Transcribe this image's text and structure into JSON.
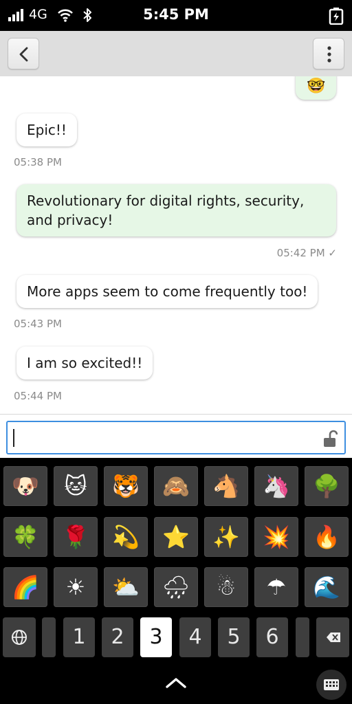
{
  "status_bar": {
    "network": "4G",
    "time": "5:45 PM",
    "icons": [
      "signal-icon",
      "wifi-icon",
      "bluetooth-icon",
      "battery-charging-icon"
    ]
  },
  "header": {
    "back_icon": "chevron-left-icon",
    "menu_icon": "kebab-menu-icon"
  },
  "messages": [
    {
      "direction": "outgoing",
      "text": "🤓"
    },
    {
      "direction": "incoming",
      "text": "Epic!!",
      "time": "05:38 PM"
    },
    {
      "direction": "outgoing",
      "text": "Revolutionary for digital rights, security, and privacy!",
      "time": "05:42 PM ✓"
    },
    {
      "direction": "incoming",
      "text": "More apps seem to come frequently too!",
      "time": "05:43 PM"
    },
    {
      "direction": "incoming",
      "text": "I am so excited!!",
      "time": "05:44 PM"
    }
  ],
  "input": {
    "value": "",
    "lock_icon": "unlocked-padlock-icon"
  },
  "keyboard": {
    "emoji_rows": [
      [
        "🐶",
        "🐱",
        "🐯",
        "🙈",
        "🐴",
        "🦄",
        "🌳"
      ],
      [
        "🍀",
        "🌹",
        "💫",
        "⭐",
        "✨",
        "💥",
        "🔥"
      ],
      [
        "🌈",
        "☀",
        "⛅",
        "🌧",
        "☃",
        "☂",
        "🌊"
      ]
    ],
    "number_keys": [
      "1",
      "2",
      "3",
      "4",
      "5",
      "6"
    ],
    "selected_key": "3",
    "icons": [
      "globe-icon",
      "backspace-icon",
      "chevron-up-icon",
      "keyboard-icon"
    ]
  }
}
